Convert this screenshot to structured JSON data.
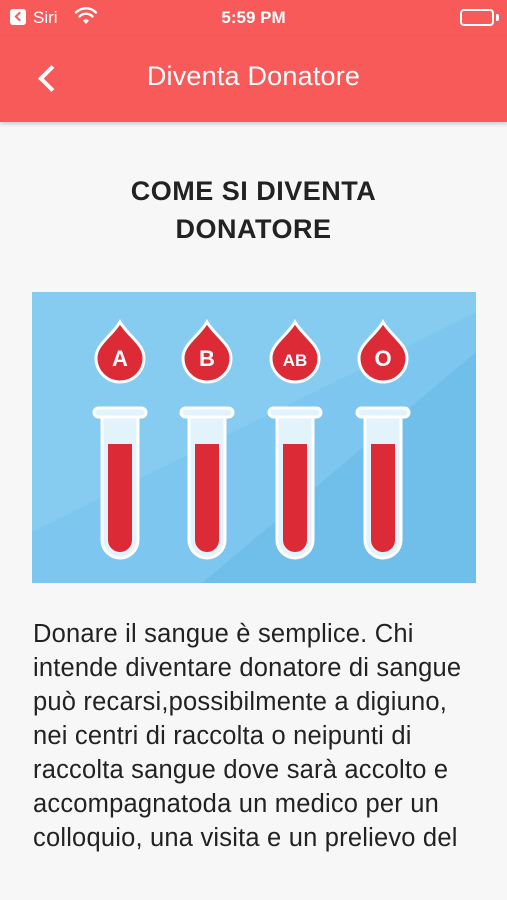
{
  "status_bar": {
    "carrier": "Siri",
    "time": "5:59 PM",
    "icons": [
      "back-to-app-icon",
      "wifi-icon",
      "battery-icon"
    ]
  },
  "nav": {
    "title": "Diventa Donatore",
    "back_icon": "chevron-left-icon"
  },
  "main": {
    "heading": "COME SI DIVENTA DONATORE",
    "illustration": {
      "blood_types": [
        "A",
        "B",
        "AB",
        "O"
      ],
      "colors": {
        "background": "#7cc6ef",
        "background_light": "#9ad6f5",
        "blood": "#dc2a36",
        "tube": "#e2f3fc"
      }
    },
    "body": "Donare il sangue è semplice. Chi intende diventare donatore di sangue può recarsi,possibilmente a digiuno, nei centri di raccolta o neipunti di raccolta sangue dove sarà accolto e accompagnatoda un medico per un colloquio, una visita e un prelievo del"
  },
  "colors": {
    "header": "#f85a5a",
    "header_text": "#ffffff",
    "page_background": "#f7f7f7",
    "text": "#222222"
  }
}
